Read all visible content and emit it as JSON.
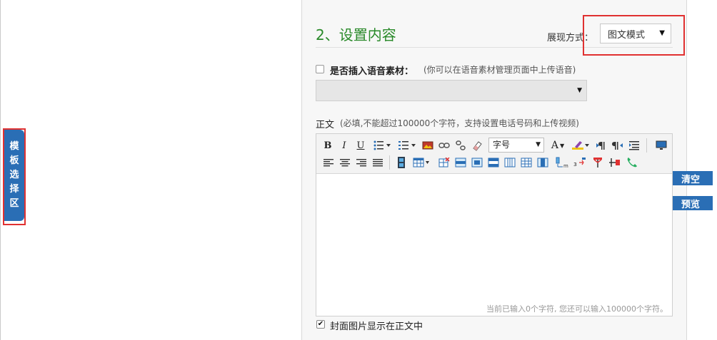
{
  "template_tab": {
    "chars": [
      "模",
      "板",
      "选",
      "择",
      "区"
    ]
  },
  "section": {
    "title": "2、设置内容"
  },
  "display_mode": {
    "label": "展现方式：",
    "value": "图文模式"
  },
  "voice": {
    "label": "是否插入语音素材：",
    "hint": "(你可以在语音素材管理页面中上传语音)",
    "value": ""
  },
  "body": {
    "label": "正文",
    "hint": "(必填,不能超过100000个字符，支持设置电话号码和上传视频)"
  },
  "editor": {
    "font_size_label": "字号",
    "bold": "B",
    "italic": "I",
    "underline": "U",
    "font_color": "A",
    "status": "当前已输入0个字符, 您还可以输入100000个字符。"
  },
  "side_buttons": {
    "clear": "清空",
    "preview": "预览"
  },
  "cover": {
    "label": "封面图片显示在正文中",
    "checked": true
  },
  "colors": {
    "accent_blue": "#2a6eb5",
    "title_green": "#2a8a2a",
    "highlight_red": "#e03131"
  }
}
